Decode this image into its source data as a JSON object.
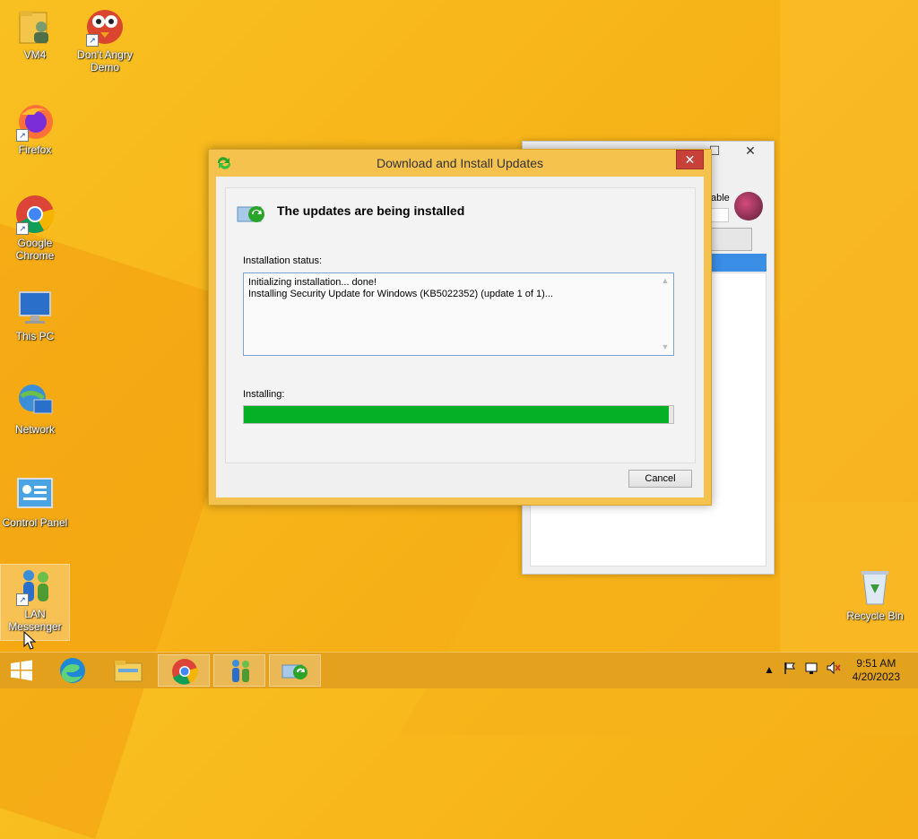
{
  "desktop": {
    "icons": [
      {
        "label": "VM4"
      },
      {
        "label": "Don't Angry Demo"
      },
      {
        "label": "Firefox"
      },
      {
        "label": "Google Chrome"
      },
      {
        "label": "This PC"
      },
      {
        "label": "Network"
      },
      {
        "label": "Control Panel"
      },
      {
        "label": "LAN Messenger"
      },
      {
        "label": "Recycle Bin"
      }
    ]
  },
  "background_window": {
    "partial_text": "able"
  },
  "dialog": {
    "title": "Download and Install Updates",
    "close_label": "✕",
    "heading": "The updates are being installed",
    "status_label": "Installation status:",
    "status_lines": [
      "Initializing installation... done!",
      "Installing Security Update for Windows (KB5022352) (update 1 of 1)..."
    ],
    "progress_label": "Installing:",
    "progress_fraction": 0.99,
    "cancel_label": "Cancel"
  },
  "taskbar": {
    "time": "9:51 AM",
    "date": "4/20/2023"
  },
  "colors": {
    "progress_fill": "#06b025",
    "close_button": "#c7403a",
    "dialog_frame": "#f5c24e"
  }
}
